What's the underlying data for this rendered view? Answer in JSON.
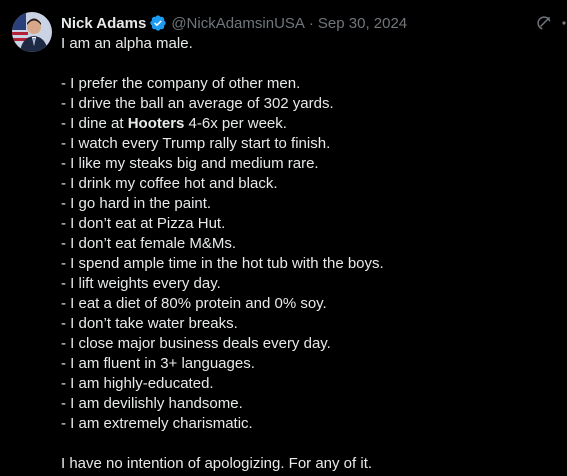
{
  "author": {
    "name": "Nick Adams",
    "handle": "@NickAdamsinUSA",
    "separator": "·",
    "date": "Sep 30, 2024"
  },
  "colors": {
    "background": "#000000",
    "text": "#e7e9ea",
    "secondary": "#71767b",
    "verified": "#1d9bf0"
  },
  "icons": {
    "verified": "verified-badge-icon",
    "grok": "grok-icon",
    "more": "more-icon"
  },
  "tweet": {
    "opening": "I am an alpha male.",
    "lines_a": [
      "- I prefer the company of other men.",
      "- I drive the ball an average of 302 yards."
    ],
    "hooters_line": {
      "prefix": "- I dine at ",
      "bold": "Hooters",
      "suffix": " 4-6x per week."
    },
    "lines_b": [
      "- I watch every Trump rally start to finish.",
      "- I like my steaks big and medium rare.",
      "- I drink my coffee hot and black.",
      "- I go hard in the paint.",
      "- I don’t eat at Pizza Hut.",
      "- I don’t eat female M&Ms.",
      "- I spend ample time in the hot tub with the boys.",
      "- I lift weights every day.",
      "- I eat a diet of 80% protein and 0% soy.",
      "- I don’t take water breaks.",
      "- I close major business deals every day.",
      "- I am fluent in 3+ languages.",
      "- I am highly-educated.",
      "- I am devilishly handsome.",
      "- I am extremely charismatic."
    ],
    "closing": "I have no intention of apologizing. For any of it."
  }
}
